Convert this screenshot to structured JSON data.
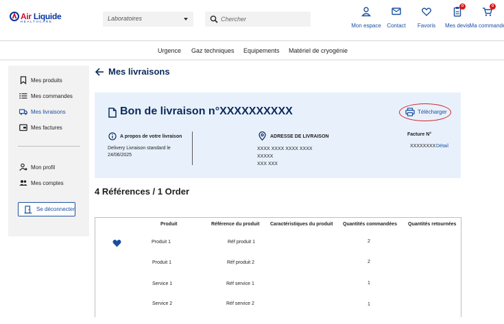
{
  "header": {
    "logo": {
      "brand_part1": "Air ",
      "brand_part2": "Liquide",
      "sub": "HEALTHCARE"
    },
    "lab_select": {
      "value": "Laboratoires"
    },
    "search": {
      "placeholder": "Chercher"
    },
    "actions": [
      {
        "label": "Mon espace",
        "icon": "user-icon"
      },
      {
        "label": "Contact",
        "icon": "mail-icon"
      },
      {
        "label": "Favoris",
        "icon": "heart-icon"
      },
      {
        "label": "Mes devis",
        "icon": "clipboard-icon",
        "badge": "0"
      },
      {
        "label": "Ma commande",
        "icon": "cart-icon",
        "badge": "0"
      }
    ]
  },
  "nav": [
    "Urgence",
    "Gaz techniques",
    "Equipements",
    "Matériel de cryogénie"
  ],
  "sidebar": {
    "items": [
      {
        "label": "Mes produits",
        "icon": "bookmark-icon"
      },
      {
        "label": "Mes commandes",
        "icon": "list-icon"
      },
      {
        "label": "Mes livraisons",
        "icon": "truck-icon",
        "active": true
      },
      {
        "label": "Mes factures",
        "icon": "invoice-icon"
      }
    ],
    "account_items": [
      {
        "label": "Mon profil",
        "icon": "profile-icon"
      },
      {
        "label": "Mes comptes",
        "icon": "accounts-icon"
      }
    ],
    "logout_label": "Se déconnecter"
  },
  "page": {
    "title": "Mes livraisons",
    "card": {
      "title": "Bon de livraison n°XXXXXXXXXX",
      "download_label": "Télécharger",
      "about_title": "A propos de votre livraison",
      "about_text": "Delivery Livraison standard le 24/06/2025",
      "address_title": "ADRESSE DE LIVRAISON",
      "address_lines": [
        "XXXX XXXX XXXX XXXX",
        "XXXXX",
        "XXX XXX"
      ],
      "invoice_title": "Facture N°",
      "invoice_value": "XXXXXXXX",
      "invoice_link": "Détail"
    },
    "refs_title": "4 Références / 1 Order",
    "table": {
      "headers": [
        "Produit",
        "Référence du produit",
        "Caractéristiques du produit",
        "Quantités commandées",
        "Quantités retournées"
      ],
      "rows": [
        {
          "product": "Produit 1",
          "reference": "Réf produit 1",
          "ordered": "2",
          "favorite": true
        },
        {
          "product": "Produit 1",
          "reference": "Réf produit 2",
          "ordered": "2",
          "favorite": false
        },
        {
          "product": "Service 1",
          "reference": "Réf service 1",
          "ordered": "1",
          "favorite": false
        },
        {
          "product": "Service 2",
          "reference": "Réf service 2",
          "ordered": "1",
          "favorite": false
        }
      ]
    }
  },
  "colors": {
    "primary": "#1a4fa0",
    "title": "#0b2a5b",
    "card_bg": "#e8f1fb",
    "alert": "#d21f26"
  }
}
